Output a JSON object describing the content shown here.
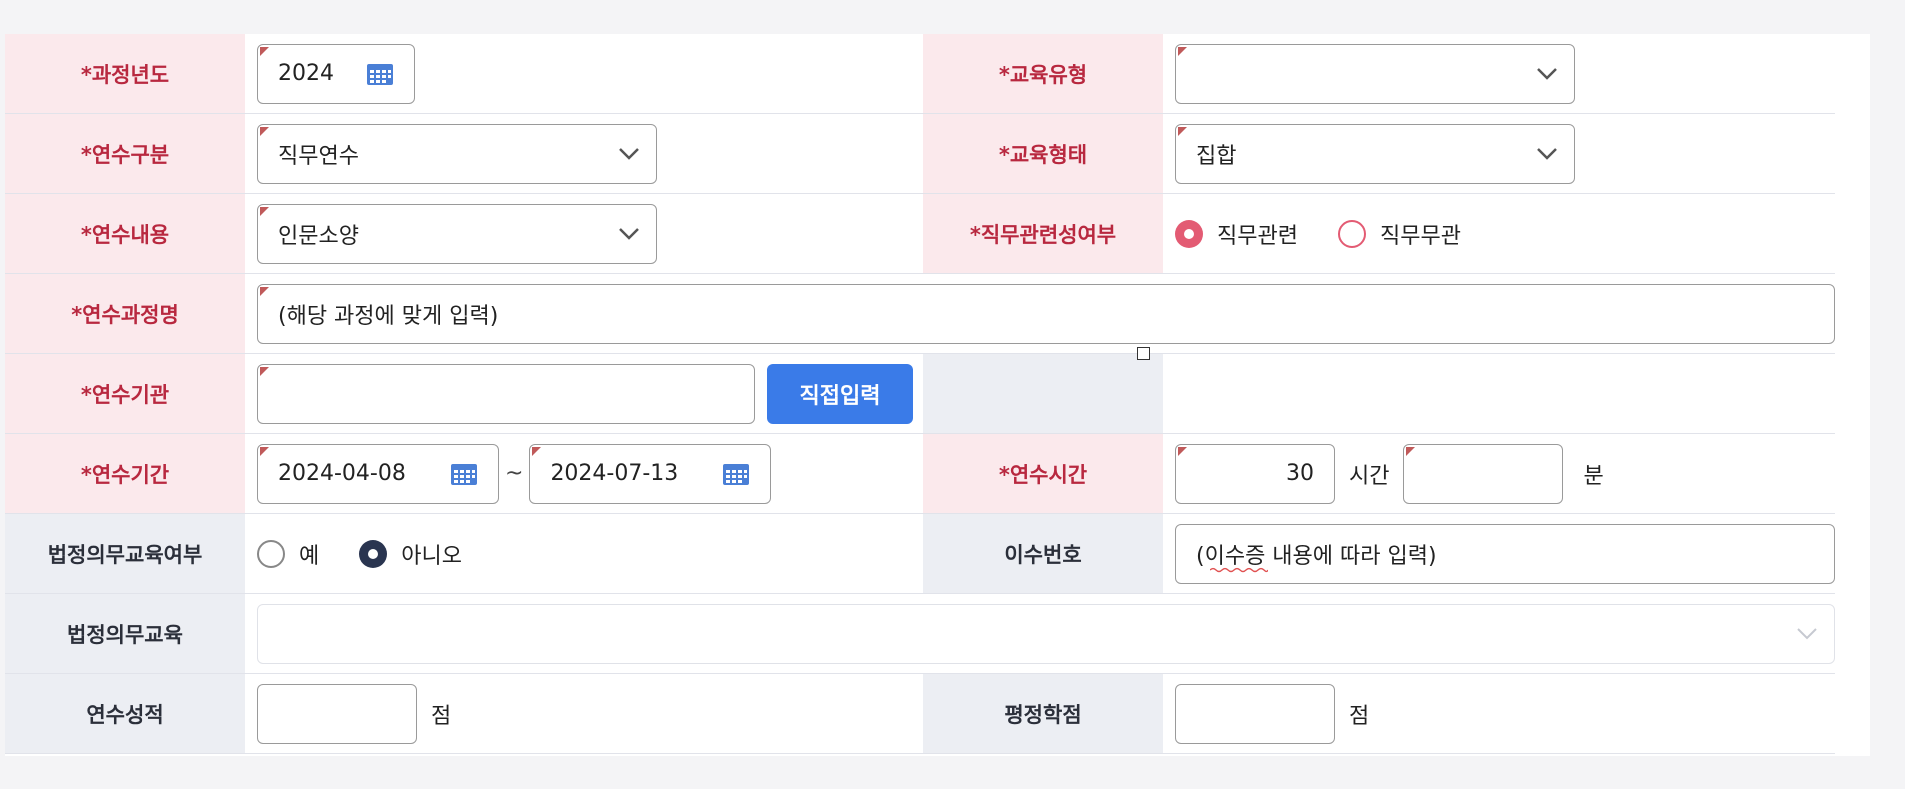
{
  "form": {
    "course_year": {
      "label": "*과정년도",
      "value": "2024"
    },
    "edu_type": {
      "label": "*교육유형",
      "value": ""
    },
    "training_category": {
      "label": "*연수구분",
      "value": "직무연수"
    },
    "edu_form": {
      "label": "*교육형태",
      "value": "집합"
    },
    "training_content": {
      "label": "*연수내용",
      "value": "인문소양"
    },
    "job_relevance": {
      "label": "*직무관련성여부",
      "options": [
        "직무관련",
        "직무무관"
      ],
      "selected": "직무관련"
    },
    "course_name": {
      "label": "*연수과정명",
      "value": "(해당 과정에 맞게 입력)"
    },
    "institution": {
      "label": "*연수기관",
      "value": "",
      "button": "직접입력"
    },
    "period": {
      "label": "*연수기간",
      "start": "2024-04-08",
      "separator": "~",
      "end": "2024-07-13"
    },
    "hours": {
      "label": "*연수시간",
      "hours_value": "30",
      "hours_unit": "시간",
      "minutes_value": "",
      "minutes_unit": "분"
    },
    "mandatory_flag": {
      "label": "법정의무교육여부",
      "options": [
        "예",
        "아니오"
      ],
      "selected": "아니오"
    },
    "completion_no": {
      "label": "이수번호",
      "value": "(이수증 내용에 따라 입력)"
    },
    "mandatory_edu": {
      "label": "법정의무교육",
      "value": ""
    },
    "score": {
      "label": "연수성적",
      "value": "",
      "unit": "점"
    },
    "credit": {
      "label": "평정학점",
      "value": "",
      "unit": "점"
    }
  },
  "colors": {
    "required_label": "#b8283f",
    "required_bg": "#fbe9ec",
    "optional_bg": "#eceef3",
    "button": "#3a7be8",
    "radio_pink": "#e35b73",
    "radio_navy": "#2a3550"
  }
}
